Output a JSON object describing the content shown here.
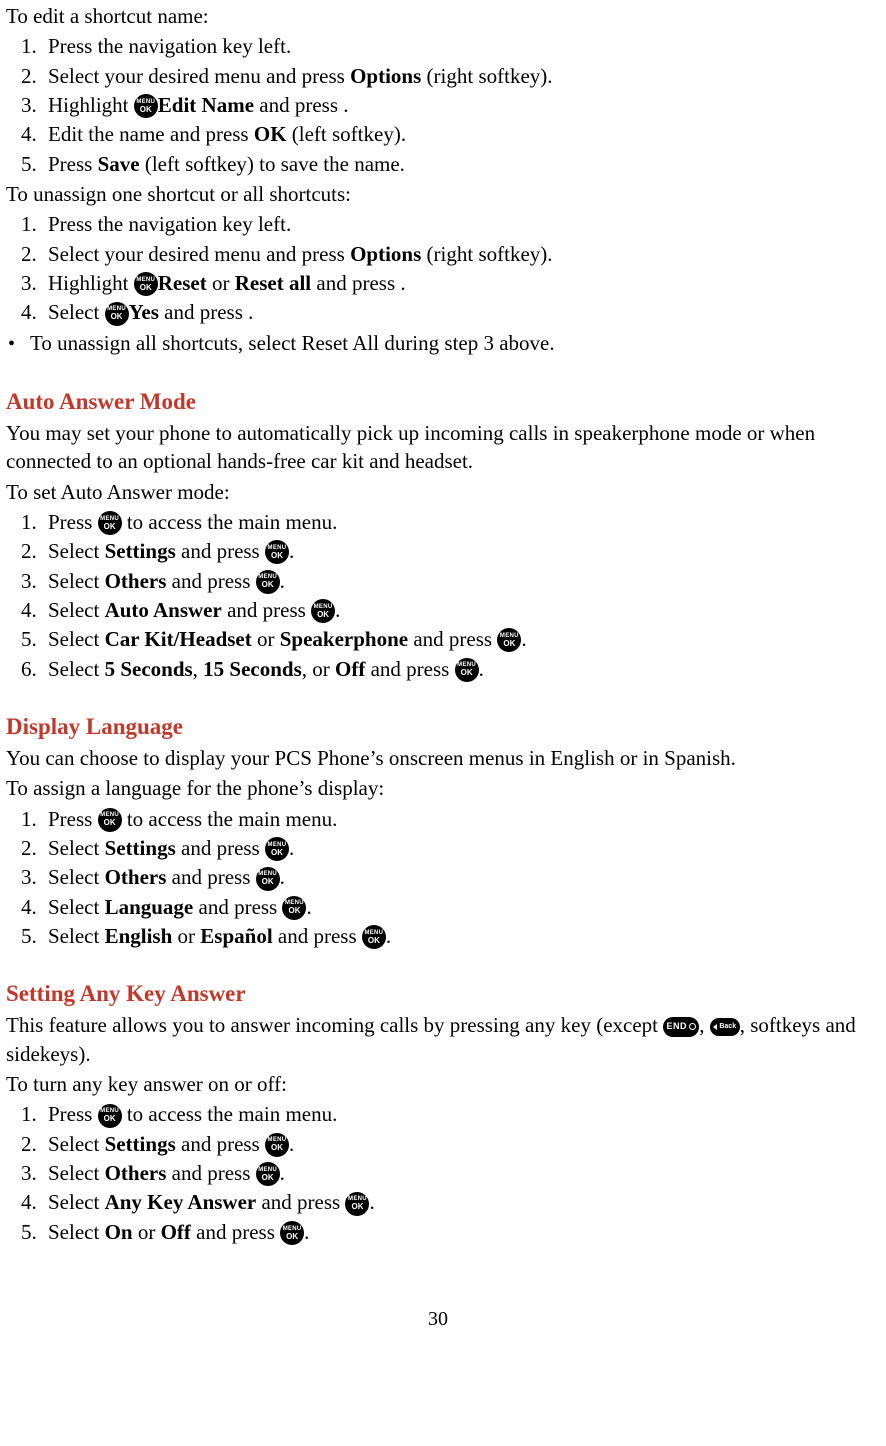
{
  "page_number": "30",
  "icons": {
    "menuok_top": "MENU",
    "menuok_bottom": "OK",
    "end": "END",
    "back": "Back"
  },
  "section_edit": {
    "intro": "To edit a shortcut name:",
    "steps": [
      {
        "a": "Press the navigation key left."
      },
      {
        "a": "Select your desired menu and press ",
        "b1": "Options",
        "c": " (right softkey)."
      },
      {
        "a": "Highlight ",
        "b1": "Edit Name",
        "c": " and press ",
        "icon": "menuok",
        "d": "."
      },
      {
        "a": "Edit the name and press ",
        "b1": "OK",
        "c": " (left softkey)."
      },
      {
        "a": "Press ",
        "b1": "Save",
        "c": " (left softkey) to save the name."
      }
    ]
  },
  "section_unassign": {
    "intro": "To unassign one shortcut or all shortcuts:",
    "steps": [
      {
        "a": "Press the navigation key left."
      },
      {
        "a": "Select your desired menu and press ",
        "b1": "Options",
        "c": " (right softkey)."
      },
      {
        "a": "Highlight ",
        "b1": "Reset",
        "mid": " or ",
        "b2": "Reset all",
        "c": " and press ",
        "icon": "menuok",
        "d": "."
      },
      {
        "a": "Select ",
        "b1": "Yes",
        "c": " and press ",
        "icon": "menuok",
        "d": "."
      }
    ],
    "bullet": "To unassign all shortcuts, select Reset All during step 3 above."
  },
  "section_auto": {
    "title": "Auto Answer Mode",
    "desc": "You may set your phone to automatically pick up incoming calls in speakerphone mode or when connected to an optional hands-free car kit and headset.",
    "intro": "To set Auto Answer mode:",
    "steps": [
      {
        "a": "Press ",
        "icon": "menuok",
        "c": " to access the main menu."
      },
      {
        "a": "Select ",
        "b1": "Settings",
        "c": " and press ",
        "icon2": "menuok",
        "d": "."
      },
      {
        "a": "Select ",
        "b1": "Others",
        "c": " and press ",
        "icon2": "menuok",
        "d": "."
      },
      {
        "a": "Select ",
        "b1": "Auto Answer",
        "c": " and press ",
        "icon2": "menuok",
        "d": "."
      },
      {
        "a": "Select ",
        "b1": "Car Kit/Headset",
        "mid": " or ",
        "b2": "Speakerphone",
        "c": " and press ",
        "icon2": "menuok",
        "d": "."
      },
      {
        "a": "Select ",
        "b1": "5 Seconds",
        "mid": ", ",
        "b2": "15 Seconds",
        "mid2": ", or ",
        "b3": "Off",
        "c": " and press ",
        "icon2": "menuok",
        "d": "."
      }
    ]
  },
  "section_lang": {
    "title": "Display Language",
    "desc": "You can choose to display your PCS Phone’s onscreen menus in English or in Spanish.",
    "intro": "To assign a language for the phone’s display:",
    "steps": [
      {
        "a": "Press ",
        "icon": "menuok",
        "c": " to access the main menu."
      },
      {
        "a": "Select ",
        "b1": "Settings",
        "c": " and press ",
        "icon2": "menuok",
        "d": "."
      },
      {
        "a": "Select ",
        "b1": "Others",
        "c": " and press ",
        "icon2": "menuok",
        "d": "."
      },
      {
        "a": "Select ",
        "b1": "Language",
        "c": " and press ",
        "icon2": "menuok",
        "d": "."
      },
      {
        "a": "Select ",
        "b1": "English",
        "mid": " or ",
        "b2": "Español",
        "c": " and press ",
        "icon2": "menuok",
        "d": "."
      }
    ]
  },
  "section_anykey": {
    "title": "Setting Any Key Answer",
    "desc_a": "This feature allows you to answer incoming calls by pressing any key (except ",
    "desc_b": ", ",
    "desc_c": ", softkeys and sidekeys).",
    "intro": "To turn any key answer on or off:",
    "steps": [
      {
        "a": "Press ",
        "icon": "menuok",
        "c": " to access the main menu."
      },
      {
        "a": "Select ",
        "b1": "Settings",
        "c": " and press ",
        "icon2": "menuok",
        "d": "."
      },
      {
        "a": "Select ",
        "b1": "Others",
        "c": " and press ",
        "icon2": "menuok",
        "d": "."
      },
      {
        "a": "Select ",
        "b1": "Any Key Answer",
        "c": " and press ",
        "icon2": "menuok",
        "d": "."
      },
      {
        "a": "Select ",
        "b1": "On",
        "mid": " or ",
        "b2": "Off",
        "c": " and press ",
        "icon2": "menuok",
        "d": "."
      }
    ]
  }
}
